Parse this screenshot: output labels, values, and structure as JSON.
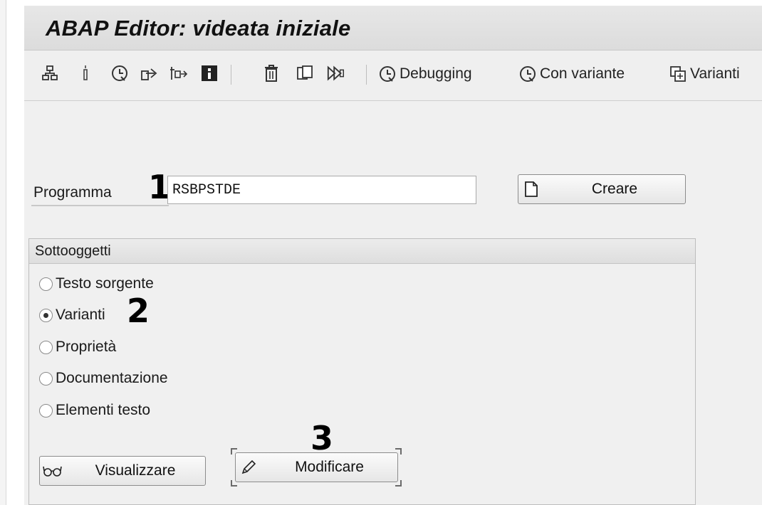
{
  "window": {
    "title": "ABAP Editor: videata iniziale"
  },
  "toolbar": {
    "icons": [
      "object-list-icon",
      "where-used-icon",
      "execute-icon",
      "navigate-icon",
      "variant-icon",
      "info-icon",
      "delete-icon",
      "copy-icon",
      "activate-icon"
    ],
    "debugging_label": "Debugging",
    "with_variant_label": "Con variante",
    "variants_label": "Varianti"
  },
  "form": {
    "program_label": "Programma",
    "program_value": "RSBPSTDE",
    "create_label": "Creare"
  },
  "subobjects": {
    "title": "Sottooggetti",
    "options": [
      {
        "label": "Testo sorgente",
        "checked": false
      },
      {
        "label": "Varianti",
        "checked": true
      },
      {
        "label": "Proprietà",
        "checked": false
      },
      {
        "label": "Documentazione",
        "checked": false
      },
      {
        "label": "Elementi testo",
        "checked": false
      }
    ],
    "display_label": "Visualizzare",
    "change_label": "Modificare"
  },
  "annotations": {
    "step1": "1",
    "step2": "2",
    "step3": "3"
  },
  "colors": {
    "title_bar": "#dcdcdc",
    "toolbar": "#efefef",
    "panel": "#f0f0f0",
    "annotation": "#000000"
  }
}
